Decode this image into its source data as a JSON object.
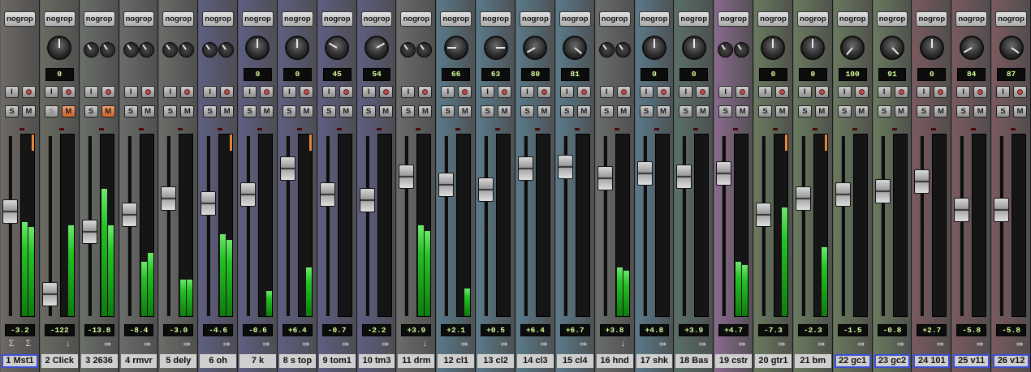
{
  "group_label": "nogrop",
  "labels": {
    "input": "I",
    "solo": "S",
    "mute": "M"
  },
  "icons": {
    "auto_down": "↓",
    "sends": "⇛",
    "sigma": "Σ"
  },
  "strips": [
    {
      "name": "1 Mst1",
      "color": "#6e6a65",
      "volume": "-3.2",
      "pan": null,
      "knob": "none",
      "fader": 0.62,
      "meter": [
        0.52,
        0.49
      ],
      "clip": true,
      "selected": true,
      "icon": "sigma",
      "mute_on": false,
      "solo_dim": false,
      "rec": false
    },
    {
      "name": "2 Click",
      "color": "#6b6b63",
      "volume": "-122",
      "pan": "0",
      "knob": "big",
      "angle": 0,
      "fader": 0.12,
      "meter": [
        0,
        0.5
      ],
      "clip": false,
      "selected": false,
      "icon": "down",
      "mute_on": true,
      "solo_dim": true,
      "rec": true
    },
    {
      "name": "3 2636",
      "color": "#6b6f6a",
      "volume": "-13.8",
      "pan": null,
      "knob": "pair",
      "fader": 0.5,
      "meter": [
        0.7,
        0.5
      ],
      "clip": false,
      "selected": false,
      "icon": "sends",
      "mute_on": true,
      "solo_dim": false,
      "rec": false
    },
    {
      "name": "4 rmvr",
      "color": "#6a6d6a",
      "volume": "-8.4",
      "pan": null,
      "knob": "pair",
      "fader": 0.6,
      "meter": [
        0.3,
        0.35
      ],
      "clip": false,
      "selected": false,
      "icon": "sends",
      "mute_on": false,
      "solo_dim": false,
      "rec": false
    },
    {
      "name": "5 dely",
      "color": "#6b6d6a",
      "volume": "-3.0",
      "pan": null,
      "knob": "pair",
      "fader": 0.7,
      "meter": [
        0.2,
        0.2
      ],
      "clip": false,
      "selected": false,
      "icon": "sends",
      "mute_on": false,
      "solo_dim": false,
      "rec": false
    },
    {
      "name": "6 oh",
      "color": "#5e5e82",
      "volume": "-4.6",
      "pan": null,
      "knob": "pair",
      "fader": 0.67,
      "meter": [
        0.45,
        0.42
      ],
      "clip": true,
      "selected": false,
      "icon": "sends",
      "mute_on": false,
      "solo_dim": false,
      "rec": true
    },
    {
      "name": "7 k",
      "color": "#5e5e82",
      "volume": "-0.6",
      "pan": "0",
      "knob": "big",
      "angle": 0,
      "fader": 0.72,
      "meter": [
        0,
        0.14
      ],
      "clip": false,
      "selected": false,
      "icon": "sends",
      "mute_on": false,
      "solo_dim": false,
      "rec": true
    },
    {
      "name": "8 s top",
      "color": "#5e5e82",
      "volume": "+6.4",
      "pan": "0",
      "knob": "big",
      "angle": 0,
      "fader": 0.88,
      "meter": [
        0,
        0.27
      ],
      "clip": true,
      "selected": false,
      "icon": "sends",
      "mute_on": false,
      "solo_dim": false,
      "rec": true
    },
    {
      "name": "9 tom1",
      "color": "#5e5e82",
      "volume": "-0.7",
      "pan": "45",
      "knob": "big",
      "angle": -60,
      "fader": 0.72,
      "meter": [
        0,
        0
      ],
      "clip": false,
      "selected": false,
      "icon": "sends",
      "mute_on": false,
      "solo_dim": false,
      "rec": true
    },
    {
      "name": "10 tm3",
      "color": "#5e5e82",
      "volume": "-2.2",
      "pan": "54",
      "knob": "big",
      "angle": 60,
      "fader": 0.69,
      "meter": [
        0,
        0
      ],
      "clip": false,
      "selected": false,
      "icon": "sends",
      "mute_on": false,
      "solo_dim": false,
      "rec": true
    },
    {
      "name": "11 drm",
      "color": "#6a6d6a",
      "volume": "+3.9",
      "pan": null,
      "knob": "pair",
      "fader": 0.83,
      "meter": [
        0.5,
        0.47
      ],
      "clip": false,
      "selected": false,
      "icon": "down",
      "mute_on": false,
      "solo_dim": false,
      "rec": false
    },
    {
      "name": "12 cl1",
      "color": "#5a7a8a",
      "volume": "+2.1",
      "pan": "66",
      "knob": "big",
      "angle": -90,
      "fader": 0.78,
      "meter": [
        0,
        0.15
      ],
      "clip": false,
      "selected": false,
      "icon": "sends",
      "mute_on": false,
      "solo_dim": false,
      "rec": true
    },
    {
      "name": "13 cl2",
      "color": "#5a7a8a",
      "volume": "+0.5",
      "pan": "63",
      "knob": "big",
      "angle": 90,
      "fader": 0.75,
      "meter": [
        0,
        0
      ],
      "clip": false,
      "selected": false,
      "icon": "sends",
      "mute_on": false,
      "solo_dim": false,
      "rec": true
    },
    {
      "name": "14 cl3",
      "color": "#5a7a8a",
      "volume": "+6.4",
      "pan": "80",
      "knob": "big",
      "angle": -120,
      "fader": 0.88,
      "meter": [
        0,
        0
      ],
      "clip": false,
      "selected": false,
      "icon": "sends",
      "mute_on": false,
      "solo_dim": false,
      "rec": true
    },
    {
      "name": "15 cl4",
      "color": "#5a7a8a",
      "volume": "+6.7",
      "pan": "81",
      "knob": "big",
      "angle": 130,
      "fader": 0.89,
      "meter": [
        0,
        0
      ],
      "clip": false,
      "selected": false,
      "icon": "sends",
      "mute_on": false,
      "solo_dim": false,
      "rec": true
    },
    {
      "name": "16 hnd",
      "color": "#6a6d6a",
      "volume": "+3.8",
      "pan": null,
      "knob": "pair",
      "fader": 0.82,
      "meter": [
        0.27,
        0.25
      ],
      "clip": false,
      "selected": false,
      "icon": "down",
      "mute_on": false,
      "solo_dim": false,
      "rec": false
    },
    {
      "name": "17 shk",
      "color": "#5a7a8a",
      "volume": "+4.8",
      "pan": "0",
      "knob": "big",
      "angle": 0,
      "fader": 0.85,
      "meter": [
        0,
        0
      ],
      "clip": false,
      "selected": false,
      "icon": "sends",
      "mute_on": false,
      "solo_dim": false,
      "rec": true
    },
    {
      "name": "18 Bas",
      "color": "#5a6f6a",
      "volume": "+3.9",
      "pan": "0",
      "knob": "big",
      "angle": 0,
      "fader": 0.83,
      "meter": [
        0,
        0
      ],
      "clip": false,
      "selected": false,
      "icon": "sends",
      "mute_on": false,
      "solo_dim": false,
      "rec": true
    },
    {
      "name": "19 cstr",
      "color": "#8a6a8e",
      "volume": "+4.7",
      "pan": null,
      "knob": "pair",
      "fader": 0.85,
      "meter": [
        0.3,
        0.28
      ],
      "clip": false,
      "selected": false,
      "icon": "sends",
      "mute_on": false,
      "solo_dim": false,
      "rec": false
    },
    {
      "name": "20 gtr1",
      "color": "#6a7a5e",
      "volume": "-7.3",
      "pan": "0",
      "knob": "big",
      "angle": 0,
      "fader": 0.6,
      "meter": [
        0,
        0.6
      ],
      "clip": true,
      "selected": false,
      "icon": "sends",
      "mute_on": false,
      "solo_dim": false,
      "rec": true
    },
    {
      "name": "21 bm",
      "color": "#6a7a5e",
      "volume": "-2.3",
      "pan": "0",
      "knob": "big",
      "angle": 0,
      "fader": 0.7,
      "meter": [
        0,
        0.38
      ],
      "clip": true,
      "selected": false,
      "icon": "sends",
      "mute_on": false,
      "solo_dim": false,
      "rec": true
    },
    {
      "name": "22 gc1",
      "color": "#6a7a5e",
      "volume": "-1.5",
      "pan": "100",
      "knob": "big",
      "angle": -140,
      "fader": 0.72,
      "meter": [
        0,
        0
      ],
      "clip": false,
      "selected": true,
      "icon": "sends",
      "mute_on": false,
      "solo_dim": false,
      "rec": true
    },
    {
      "name": "23 gc2",
      "color": "#6a7a5e",
      "volume": "-0.8",
      "pan": "91",
      "knob": "big",
      "angle": 135,
      "fader": 0.74,
      "meter": [
        0,
        0
      ],
      "clip": false,
      "selected": true,
      "icon": "sends",
      "mute_on": false,
      "solo_dim": false,
      "rec": true
    },
    {
      "name": "24 101",
      "color": "#7a5a5e",
      "volume": "+2.7",
      "pan": "0",
      "knob": "big",
      "angle": 0,
      "fader": 0.8,
      "meter": [
        0,
        0
      ],
      "clip": false,
      "selected": true,
      "icon": "sends",
      "mute_on": false,
      "solo_dim": false,
      "rec": true
    },
    {
      "name": "25 v11",
      "color": "#7a5a5e",
      "volume": "-5.8",
      "pan": "84",
      "knob": "big",
      "angle": -120,
      "fader": 0.63,
      "meter": [
        0,
        0
      ],
      "clip": false,
      "selected": true,
      "icon": "sends",
      "mute_on": false,
      "solo_dim": false,
      "rec": true
    },
    {
      "name": "26 v12",
      "color": "#7a5a5e",
      "volume": "-5.8",
      "pan": "87",
      "knob": "big",
      "angle": 125,
      "fader": 0.63,
      "meter": [
        0,
        0
      ],
      "clip": false,
      "selected": true,
      "icon": "sends",
      "mute_on": false,
      "solo_dim": false,
      "rec": true
    }
  ]
}
